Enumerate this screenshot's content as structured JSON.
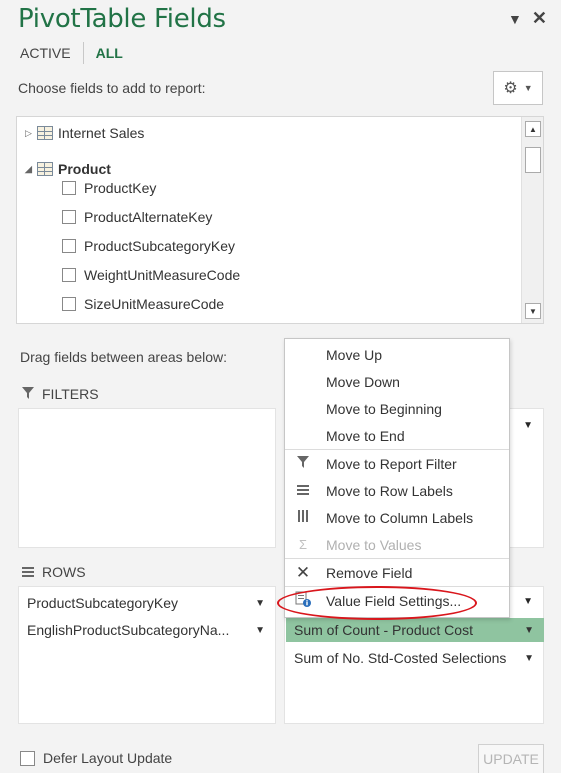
{
  "header": {
    "title": "PivotTable Fields",
    "dropdown_icon": "chevron-down-icon",
    "close_icon": "close-icon"
  },
  "tabs": {
    "active": "ACTIVE",
    "all": "ALL"
  },
  "choose_label": "Choose fields to add to report:",
  "settings_icon": "gear-icon",
  "fields": {
    "tables": [
      {
        "name": "Internet Sales",
        "expanded": false
      },
      {
        "name": "Product",
        "expanded": true
      }
    ],
    "product_fields": [
      "ProductKey",
      "ProductAlternateKey",
      "ProductSubcategoryKey",
      "WeightUnitMeasureCode",
      "SizeUnitMeasureCode"
    ]
  },
  "drag_label": "Drag fields between areas below:",
  "areas": {
    "filters": {
      "label": "FILTERS"
    },
    "rows": {
      "label": "ROWS",
      "items": [
        "ProductSubcategoryKey",
        "EnglishProductSubcategoryNa..."
      ]
    },
    "values": {
      "items": [
        "Sum of Count - Product Cost",
        "Sum of No. Std-Costed Selections"
      ]
    }
  },
  "context_menu": {
    "items": [
      {
        "label": "Move Up",
        "enabled": true
      },
      {
        "label": "Move Down",
        "enabled": true
      },
      {
        "label": "Move to Beginning",
        "enabled": true
      },
      {
        "label": "Move to End",
        "enabled": true
      },
      {
        "label": "Move to Report Filter",
        "icon": "filter-icon",
        "enabled": true
      },
      {
        "label": "Move to Row Labels",
        "icon": "rows-icon",
        "enabled": true
      },
      {
        "label": "Move to Column Labels",
        "icon": "columns-icon",
        "enabled": true
      },
      {
        "label": "Move to Values",
        "icon": "sigma-icon",
        "enabled": false
      },
      {
        "label": "Remove Field",
        "icon": "remove-icon",
        "enabled": true
      },
      {
        "label": "Value Field Settings...",
        "icon": "field-settings-icon",
        "enabled": true
      }
    ]
  },
  "footer": {
    "defer_label": "Defer Layout Update",
    "update_label": "UPDATE"
  },
  "colors": {
    "accent": "#217346",
    "selected_value_bg": "#8fc4a0",
    "highlight_oval": "#d9161c"
  }
}
